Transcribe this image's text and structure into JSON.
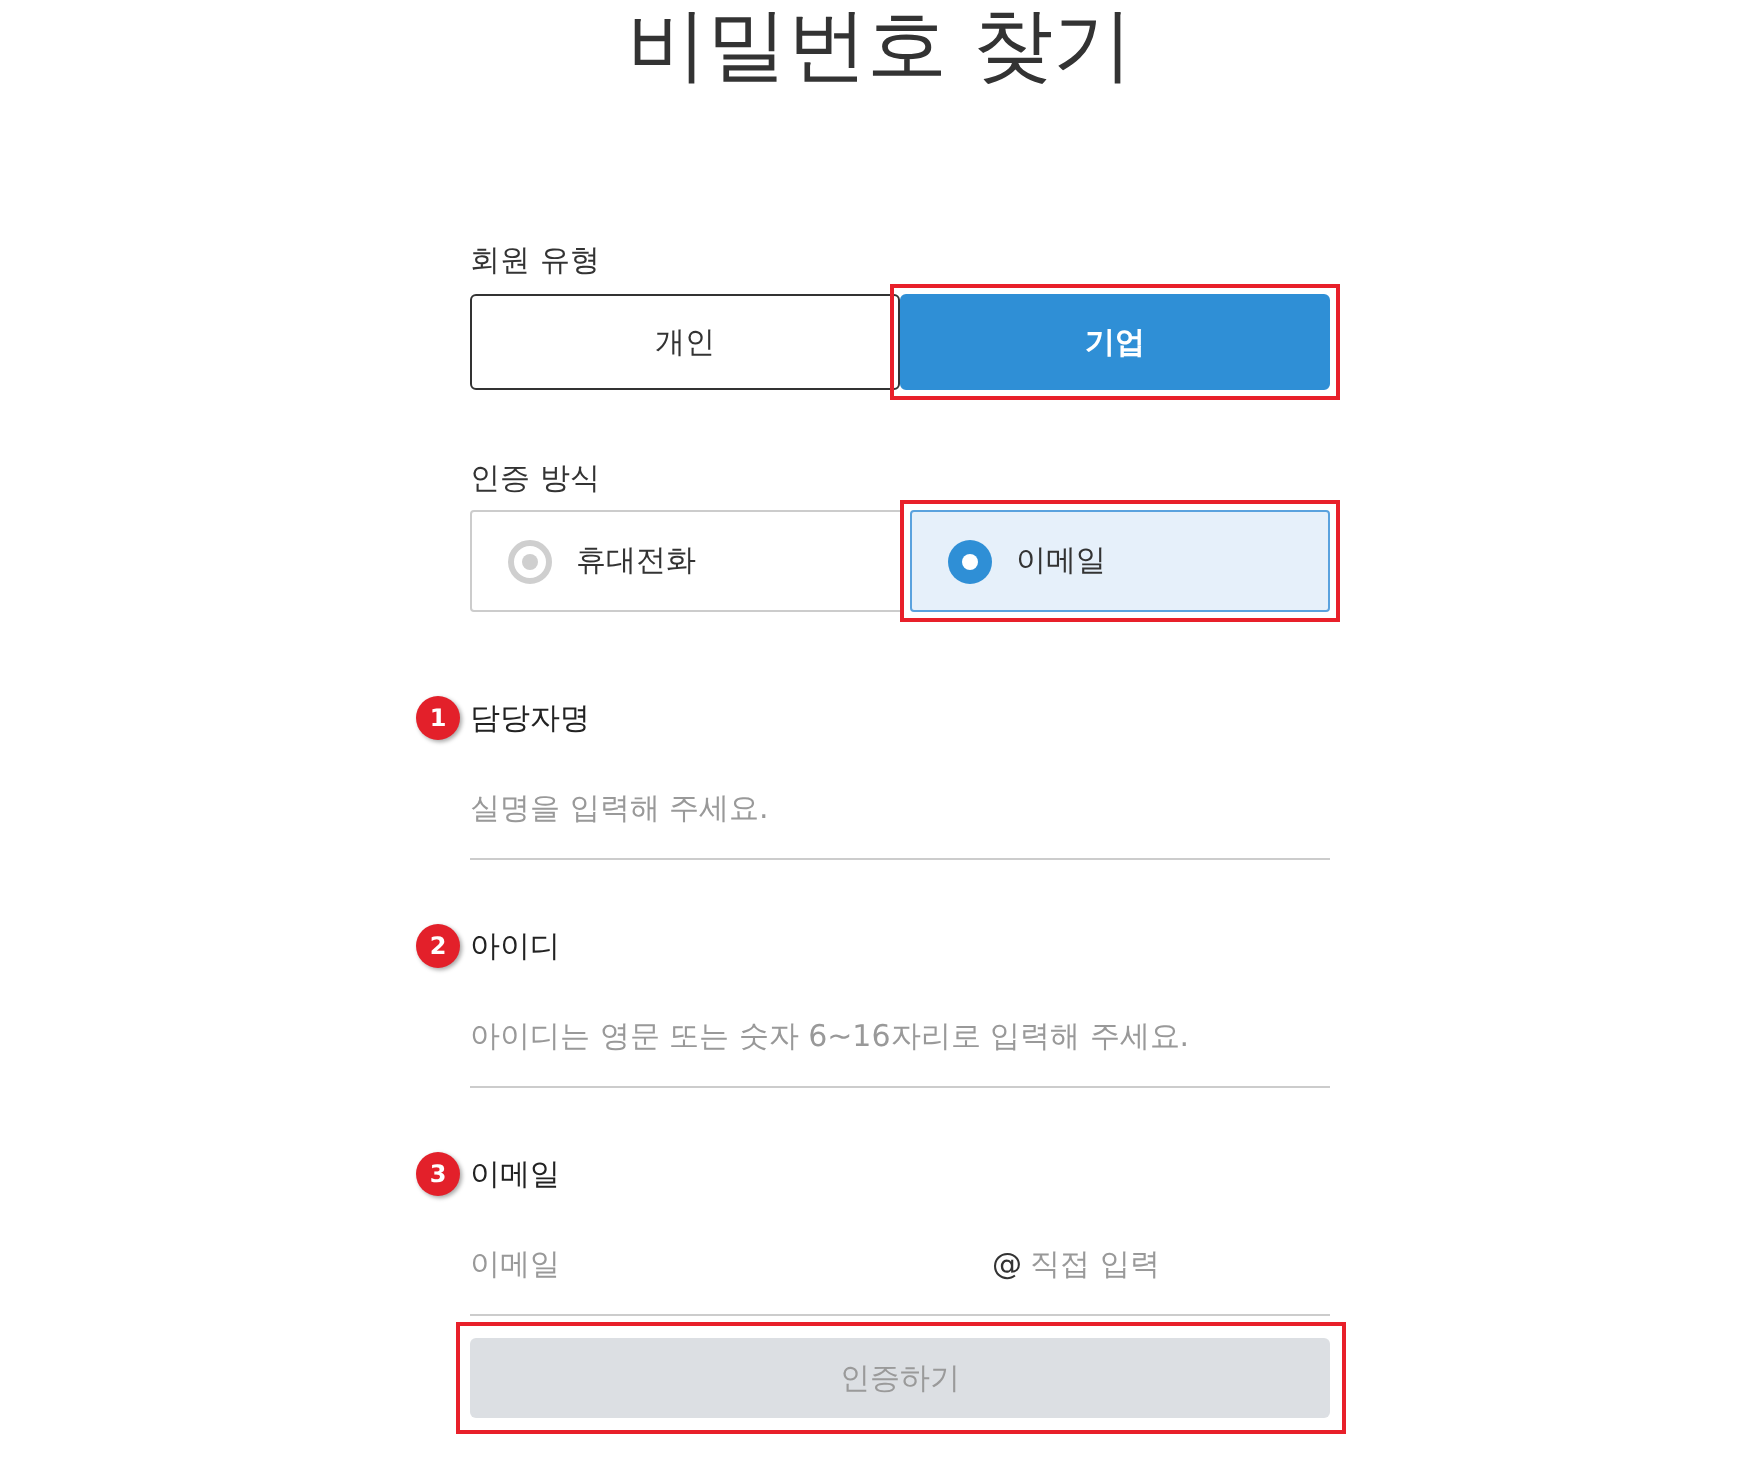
{
  "title": "비밀번호 찾기",
  "member_type": {
    "label": "회원 유형",
    "options": [
      {
        "label": "개인",
        "selected": false,
        "highlighted": false
      },
      {
        "label": "기업",
        "selected": true,
        "highlighted": true
      }
    ]
  },
  "auth_method": {
    "label": "인증 방식",
    "options": [
      {
        "label": "휴대전화",
        "selected": false,
        "highlighted": false
      },
      {
        "label": "이메일",
        "selected": true,
        "highlighted": true
      }
    ]
  },
  "fields": [
    {
      "kind": "text",
      "badge": "1",
      "label": "담당자명",
      "placeholder": "실명을 입력해 주세요."
    },
    {
      "kind": "text",
      "badge": "2",
      "label": "아이디",
      "placeholder": "아이디는 영문 또는 숫자 6~16자리로 입력해 주세요."
    },
    {
      "kind": "email",
      "badge": "3",
      "label": "이메일",
      "placeholder": "이메일",
      "separator": "@",
      "domain_placeholder": "직접 입력"
    }
  ],
  "submit": {
    "label": "인증하기",
    "disabled": true,
    "highlighted": true
  }
}
